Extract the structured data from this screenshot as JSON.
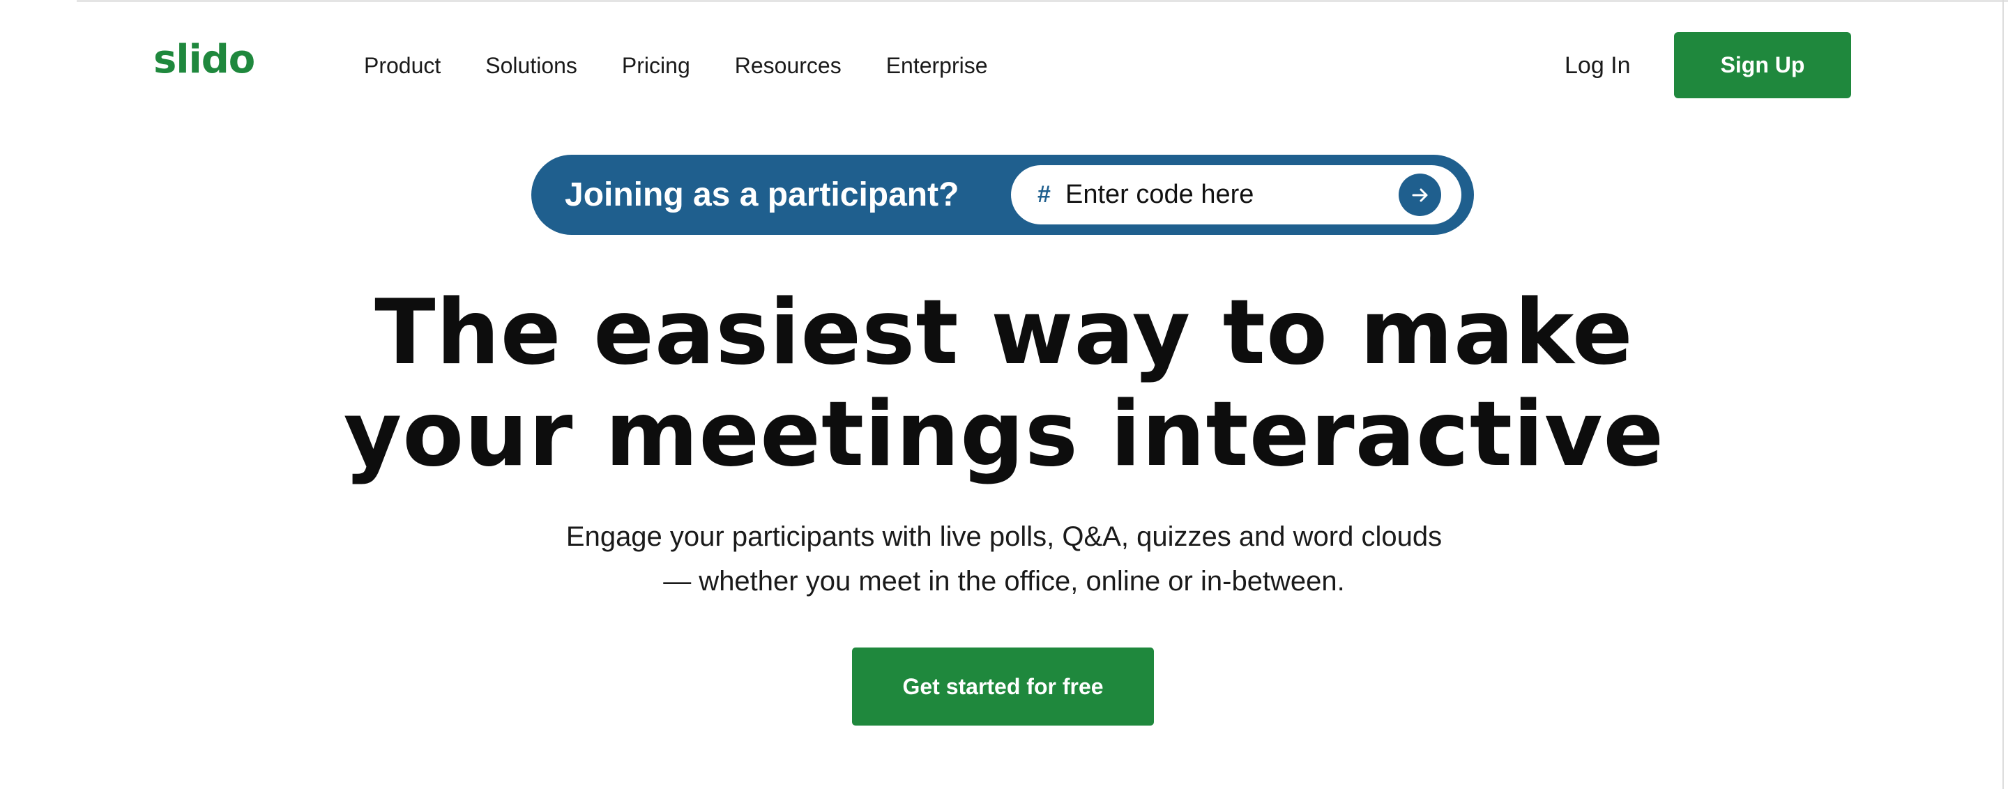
{
  "brand": {
    "logo_text": "slido",
    "primary_color": "#1f883d",
    "accent_color": "#1f5f8e"
  },
  "nav": {
    "items": [
      "Product",
      "Solutions",
      "Pricing",
      "Resources",
      "Enterprise"
    ],
    "login_label": "Log In",
    "signup_label": "Sign Up"
  },
  "join": {
    "label": "Joining as a participant?",
    "hash_symbol": "#",
    "placeholder": "Enter code here",
    "value": "",
    "submit_icon": "arrow-right-icon"
  },
  "hero": {
    "title_line1": "The easiest way to make",
    "title_line2": "your meetings interactive",
    "subtitle_line1": "Engage your participants with live polls, Q&A, quizzes and word clouds",
    "subtitle_line2": "— whether you meet in the office, online or in-between.",
    "cta_label": "Get started for free"
  }
}
